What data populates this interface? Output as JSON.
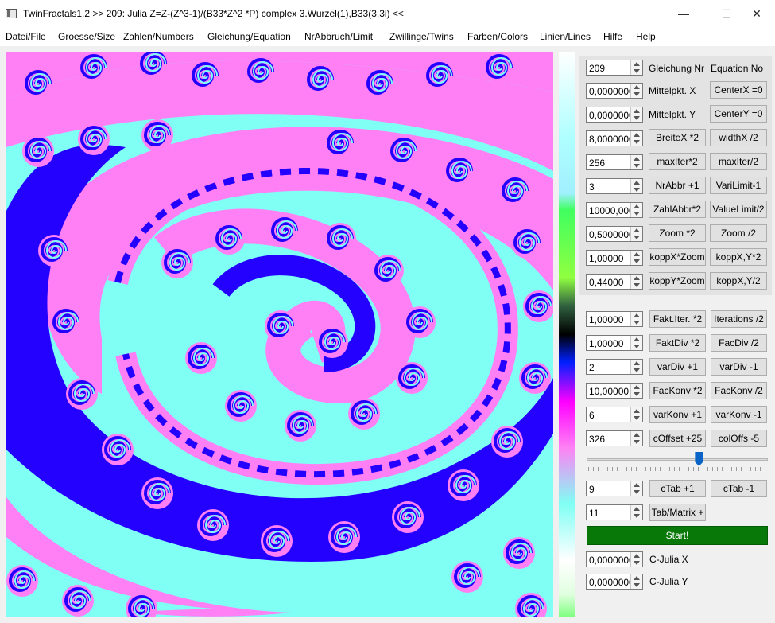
{
  "window": {
    "title": "TwinFractals1.2 >> 209: Julia Z=Z-(Z^3-1)/(B33*Z^2 *P) complex 3.Wurzel(1),B33(3,3i) <<",
    "minimize": "—",
    "maximize": "☐",
    "close": "✕"
  },
  "menu": [
    "Datei/File",
    "Groesse/Size",
    "Zahlen/Numbers",
    "Gleichung/Equation",
    "NrAbbruch/Limit",
    "Zwillinge/Twins",
    "Farben/Colors",
    "Linien/Lines",
    "Hilfe",
    "Help"
  ],
  "colors": {
    "pink": "#ff80f4",
    "cyan": "#80fff4",
    "blue": "#2400ff",
    "start_green": "#087808",
    "slider_thumb": "#0a64c8"
  },
  "params": {
    "equation_nr": {
      "value": "209",
      "label": "Gleichung Nr",
      "label2": "Equation No"
    },
    "center_x": {
      "value": "0,0000000",
      "label": "Mittelpkt. X",
      "button": "CenterX =0"
    },
    "center_y": {
      "value": "0,0000000",
      "label": "Mittelpkt. Y",
      "button": "CenterY =0"
    },
    "width_x": {
      "value": "8,0000000",
      "btn1": "BreiteX *2",
      "btn2": "widthX /2"
    },
    "max_iter": {
      "value": "256",
      "btn1": "maxIter*2",
      "btn2": "maxIter/2"
    },
    "nr_abbr": {
      "value": "3",
      "btn1": "NrAbbr +1",
      "btn2": "VariLimit-1"
    },
    "zahl_abbr": {
      "value": "10000,000",
      "btn1": "ZahlAbbr*2",
      "btn2": "ValueLimit/2"
    },
    "zoom": {
      "value": "0,5000000",
      "btn1": "Zoom *2",
      "btn2": "Zoom /2"
    },
    "kopp_x": {
      "value": "1,00000",
      "btn1": "koppX*Zoom",
      "btn2": "koppX,Y*2"
    },
    "kopp_y": {
      "value": "0,44000",
      "btn1": "koppY*Zoom",
      "btn2": "koppX,Y/2"
    }
  },
  "factors": {
    "fakt_iter": {
      "value": "1,00000",
      "btn1": "Fakt.Iter. *2",
      "btn2": "Iterations /2"
    },
    "fakt_div": {
      "value": "1,00000",
      "btn1": "FaktDiv *2",
      "btn2": "FacDiv /2"
    },
    "var_div": {
      "value": "2",
      "btn1": "varDiv +1",
      "btn2": "varDiv -1"
    },
    "fac_konv": {
      "value": "10,00000",
      "btn1": "FacKonv *2",
      "btn2": "FacKonv /2"
    },
    "var_konv": {
      "value": "6",
      "btn1": "varKonv +1",
      "btn2": "varKonv -1"
    },
    "c_offset": {
      "value": "326",
      "btn1": "cOffset +25",
      "btn2": "colOffs -5"
    }
  },
  "slider": {
    "position": 0.62
  },
  "ctab": {
    "value": "9",
    "btn1": "cTab +1",
    "btn2": "cTab -1"
  },
  "tabmatrix": {
    "value": "11",
    "btn": "Tab/Matrix +"
  },
  "start": "Start!",
  "cjulia": {
    "x": {
      "value": "0,0000000",
      "label": "C-Julia X"
    },
    "y": {
      "value": "0,0000000",
      "label": "C-Julia Y"
    }
  }
}
